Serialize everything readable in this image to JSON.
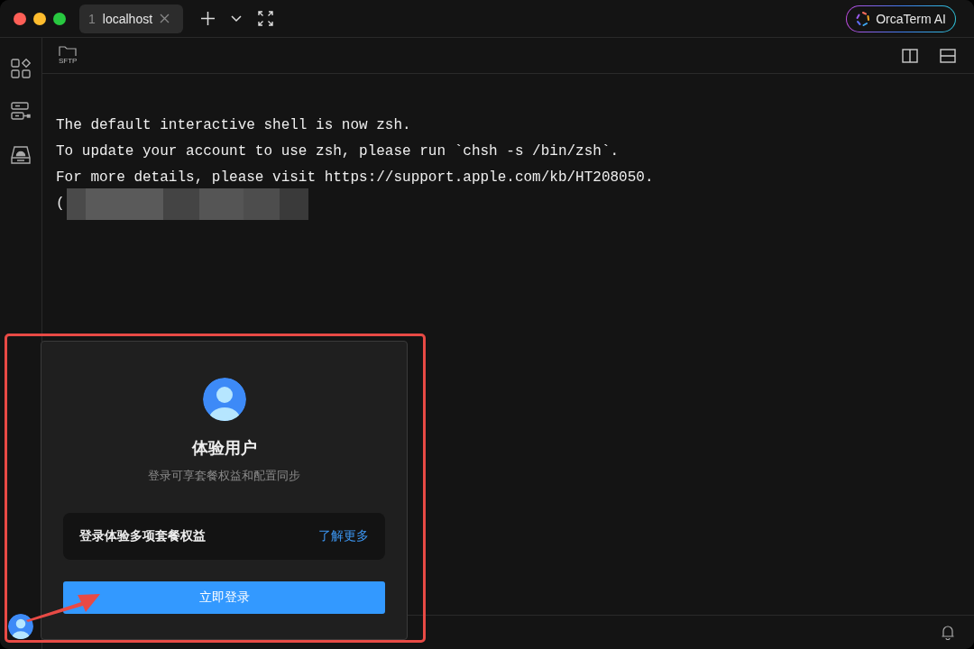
{
  "tabs": [
    {
      "number": "1",
      "label": "localhost",
      "selected": true
    }
  ],
  "ai_button": {
    "label": "OrcaTerm AI"
  },
  "toolbar": {
    "sftp_label": "SFTP"
  },
  "terminal": {
    "lines": [
      "The default interactive shell is now zsh.",
      "To update your account to use zsh, please run `chsh -s /bin/zsh`.",
      "For more details, please visit https://support.apple.com/kb/HT208050.",
      "("
    ]
  },
  "popup": {
    "name": "体验用户",
    "subtitle": "登录可享套餐权益和配置同步",
    "benefit": "登录体验多项套餐权益",
    "learn_more": "了解更多",
    "login_button": "立即登录"
  }
}
